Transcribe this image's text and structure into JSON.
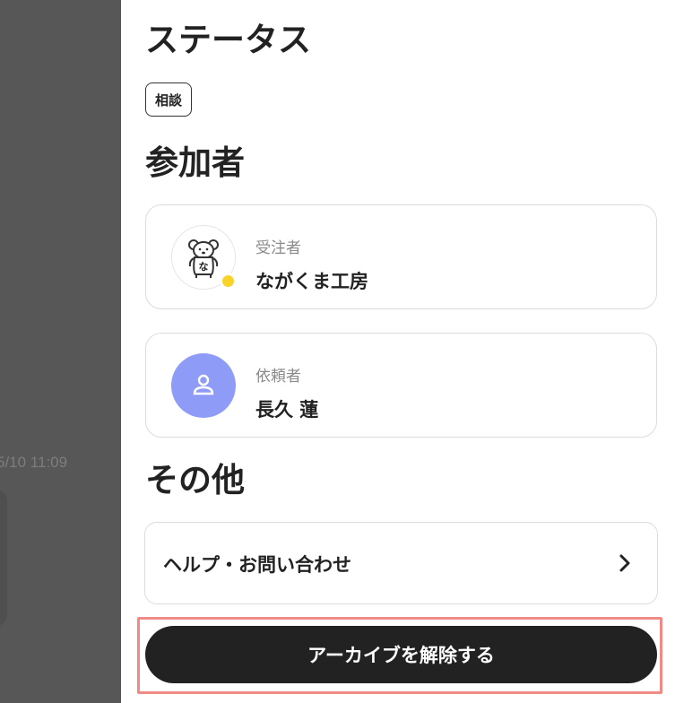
{
  "background": {
    "timestamp": "5/10 11:09"
  },
  "panel": {
    "status_heading": "ステータス",
    "status_badge": "相談",
    "participants_heading": "参加者",
    "participants": [
      {
        "role": "受注者",
        "name": "ながくま工房",
        "avatar_icon": "bear-logo-icon",
        "avatar_text": "な",
        "online": true
      },
      {
        "role": "依頼者",
        "name": "長久 蓮",
        "avatar_icon": "person-icon",
        "avatar_color": "#8f9cf7"
      }
    ],
    "other_heading": "その他",
    "help_label": "ヘルプ・お問い合わせ",
    "unarchive_button": "アーカイブを解除する"
  },
  "colors": {
    "overlay": "#575757",
    "button_bg": "#222222",
    "highlight": "#ef8a84",
    "online_dot": "#f8d32a"
  }
}
